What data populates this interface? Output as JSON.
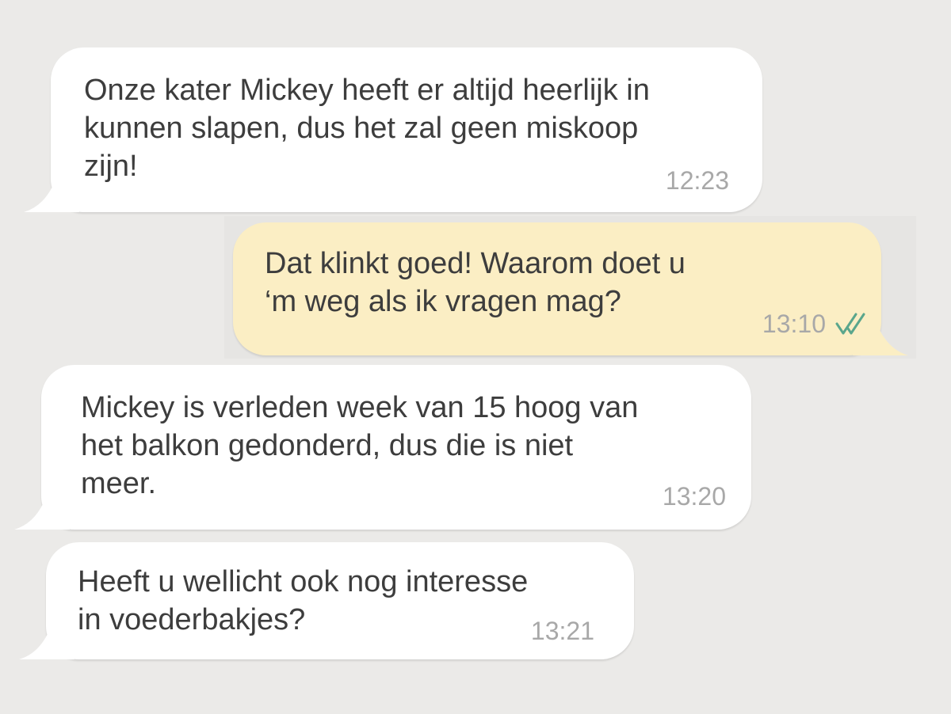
{
  "colors": {
    "background": "#ebeae8",
    "incoming_bubble": "#ffffff",
    "outgoing_bubble": "#fbeec4",
    "text": "#3d3d3d",
    "timestamp": "#a8a8a8",
    "read_check": "#5aa68c"
  },
  "messages": [
    {
      "direction": "incoming",
      "text": "Onze kater Mickey heeft er altijd heerlijk in\nkunnen slapen, dus het zal geen miskoop\nzijn!",
      "time": "12:23"
    },
    {
      "direction": "outgoing",
      "text": "Dat klinkt goed! Waarom doet u\n‘m weg als ik vragen mag?",
      "time": "13:10",
      "status_icon": "double-check-icon"
    },
    {
      "direction": "incoming",
      "text": "Mickey is verleden week van 15 hoog van\nhet balkon gedonderd, dus die is niet\nmeer.",
      "time": "13:20"
    },
    {
      "direction": "incoming",
      "text": "Heeft u wellicht ook nog interesse\nin voederbakjes?",
      "time": "13:21"
    }
  ]
}
